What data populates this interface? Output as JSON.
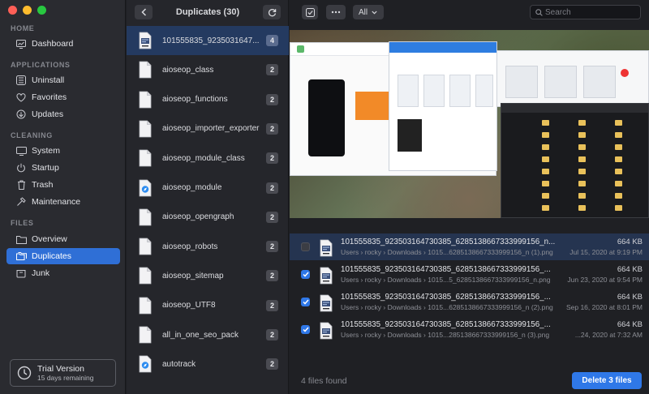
{
  "window": {
    "controls": [
      "close",
      "minimize",
      "zoom"
    ]
  },
  "sidebar": {
    "sections": [
      {
        "label": "HOME",
        "items": [
          {
            "label": "Dashboard",
            "icon": "dashboard-icon"
          }
        ]
      },
      {
        "label": "APPLICATIONS",
        "items": [
          {
            "label": "Uninstall",
            "icon": "uninstall-icon"
          },
          {
            "label": "Favorites",
            "icon": "heart-icon"
          },
          {
            "label": "Updates",
            "icon": "updates-icon"
          }
        ]
      },
      {
        "label": "CLEANING",
        "items": [
          {
            "label": "System",
            "icon": "monitor-icon"
          },
          {
            "label": "Startup",
            "icon": "power-icon"
          },
          {
            "label": "Trash",
            "icon": "trash-icon"
          },
          {
            "label": "Maintenance",
            "icon": "hammer-icon"
          }
        ]
      },
      {
        "label": "FILES",
        "items": [
          {
            "label": "Overview",
            "icon": "folder-icon"
          },
          {
            "label": "Duplicates",
            "icon": "duplicates-icon",
            "active": true
          },
          {
            "label": "Junk",
            "icon": "junk-icon"
          }
        ]
      }
    ],
    "trial": {
      "title": "Trial Version",
      "subtitle": "15 days remaining"
    }
  },
  "file_list": {
    "title": "Duplicates (30)",
    "items": [
      {
        "name": "101555835_9235031647...",
        "count": "4",
        "type": "image"
      },
      {
        "name": "aioseop_class",
        "count": "2",
        "type": "doc"
      },
      {
        "name": "aioseop_functions",
        "count": "2",
        "type": "doc"
      },
      {
        "name": "aioseop_importer_exporter",
        "count": "2",
        "type": "doc"
      },
      {
        "name": "aioseop_module_class",
        "count": "2",
        "type": "doc"
      },
      {
        "name": "aioseop_module",
        "count": "2",
        "type": "safari"
      },
      {
        "name": "aioseop_opengraph",
        "count": "2",
        "type": "doc"
      },
      {
        "name": "aioseop_robots",
        "count": "2",
        "type": "doc"
      },
      {
        "name": "aioseop_sitemap",
        "count": "2",
        "type": "doc"
      },
      {
        "name": "aioseop_UTF8",
        "count": "2",
        "type": "doc"
      },
      {
        "name": "all_in_one_seo_pack",
        "count": "2",
        "type": "doc"
      },
      {
        "name": "autotrack",
        "count": "2",
        "type": "safari"
      }
    ]
  },
  "toolbar": {
    "filter": "All",
    "search_placeholder": "Search"
  },
  "duplicates": [
    {
      "name": "101555835_923503164730385_6285138667333999156_n...",
      "path": "Users › rocky › Downloads › 1015...6285138667333999156_n (1).png",
      "size": "664 KB",
      "date": "Jul 15, 2020 at 9:19 PM",
      "checked": false
    },
    {
      "name": "101555835_923503164730385_6285138667333999156_...",
      "path": "Users › rocky › Downloads › 1015...5_6285138667333999156_n.png",
      "size": "664 KB",
      "date": "Jun 23, 2020 at 9:54 PM",
      "checked": true
    },
    {
      "name": "101555835_923503164730385_6285138667333999156_...",
      "path": "Users › rocky › Downloads › 1015...6285138667333999156_n (2).png",
      "size": "664 KB",
      "date": "Sep 16, 2020 at 8:01 PM",
      "checked": true
    },
    {
      "name": "101555835_923503164730385_6285138667333999156_...",
      "path": "Users › rocky › Downloads › 1015...285138667333999156_n (3).png",
      "size": "664 KB",
      "date": "...24, 2020 at 7:32 AM",
      "checked": true
    }
  ],
  "footer": {
    "found": "4 files found",
    "delete_label": "Delete 3 files"
  },
  "colors": {
    "accent": "#2f78e8",
    "sidebar_active": "#2f6fd6",
    "background": "#1e1f23"
  }
}
